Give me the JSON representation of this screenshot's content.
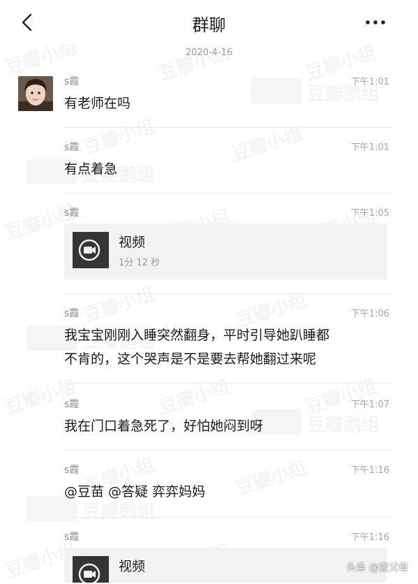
{
  "header": {
    "title": "群聊"
  },
  "date": "2020-4-16",
  "messages": [
    {
      "sender": "s霞",
      "time": "下午1:01",
      "text": "有老师在吗"
    },
    {
      "sender": "s霞",
      "time": "下午1:01",
      "text": "有点着急"
    },
    {
      "sender": "s霞",
      "time": "下午1:05",
      "video": {
        "title": "视频",
        "duration": "1分 12 秒"
      }
    },
    {
      "sender": "s霞",
      "time": "下午1:06",
      "lines": [
        "我宝宝刚刚入睡突然翻身，平时引导她趴睡都",
        "不肯的，这个哭声是不是要去帮她翻过来呢"
      ]
    },
    {
      "sender": "s霞",
      "time": "下午1:07",
      "text": "我在门口着急死了，好怕她闷到呀"
    },
    {
      "sender": "s霞",
      "time": "下午1:16",
      "text": "@豆苗 @答疑 弈弈妈妈"
    },
    {
      "sender": "s霞",
      "time": "下午1:16",
      "video": {
        "title": "视频"
      }
    }
  ],
  "watermarks": {
    "small_group": "豆瓣小组",
    "goose_group": "豆瓣鹅组",
    "box": "豆瓣"
  },
  "footer_tag": "头条 @壹父母"
}
